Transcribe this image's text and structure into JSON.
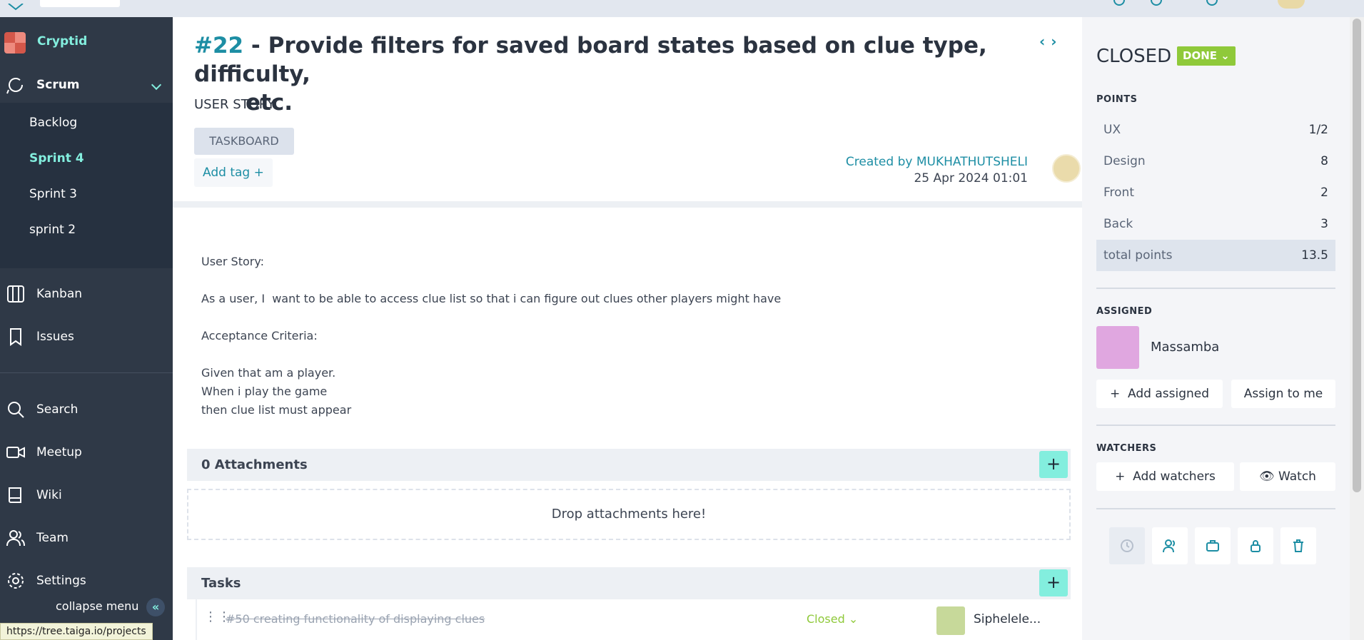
{
  "app": {
    "project_name": "Cryptid"
  },
  "sidebar": {
    "scrum_label": "Scrum",
    "sprints": [
      "Backlog",
      "Sprint 4",
      "Sprint 3",
      "sprint 2"
    ],
    "active_sprint": "Sprint 4",
    "items": [
      {
        "label": "Kanban",
        "icon": "kanban-icon"
      },
      {
        "label": "Issues",
        "icon": "bookmark-icon"
      },
      {
        "label": "Search",
        "icon": "search-icon"
      },
      {
        "label": "Meetup",
        "icon": "video-icon"
      },
      {
        "label": "Wiki",
        "icon": "book-icon"
      },
      {
        "label": "Team",
        "icon": "team-icon"
      },
      {
        "label": "Settings",
        "icon": "gear-icon"
      }
    ],
    "collapse_label": "collapse menu"
  },
  "story": {
    "ref": "#22",
    "dash": "-",
    "title_line1": "Provide filters for saved board states based on clue type, difficulty,",
    "title_line2": "etc.",
    "type": "USER STORY",
    "tag": "TASKBOARD",
    "add_tag": "Add tag",
    "created_by": "Created by MUKHATHUTSHELI",
    "created_date": "25 Apr 2024 01:01",
    "description": [
      "User Story:",
      "",
      "As a user, I  want to be able to access clue list so that i can figure out clues other players might have",
      "",
      "Acceptance Criteria:",
      "",
      "Given that am a player.",
      "When i play the game",
      "then clue list must appear"
    ]
  },
  "attachments": {
    "title": "0 Attachments",
    "drop_text": "Drop attachments here!"
  },
  "tasks": {
    "title": "Tasks",
    "items": [
      {
        "ref": "#50",
        "name": "creating functionality of displaying clues",
        "status": "Closed",
        "assignee": "Siphelele..."
      }
    ]
  },
  "panel": {
    "status": "CLOSED",
    "status_badge": "DONE",
    "points_label": "POINTS",
    "points": [
      {
        "role": "UX",
        "value": "1/2"
      },
      {
        "role": "Design",
        "value": "8"
      },
      {
        "role": "Front",
        "value": "2"
      },
      {
        "role": "Back",
        "value": "3"
      }
    ],
    "total_label": "total points",
    "total_value": "13.5",
    "assigned_label": "ASSIGNED",
    "assignee": "Massamba",
    "add_assigned": "Add assigned",
    "assign_to_me": "Assign to me",
    "watchers_label": "WATCHERS",
    "add_watchers": "Add watchers",
    "watch": "Watch"
  },
  "statusbar": {
    "url": "https://tree.taiga.io/projects"
  },
  "colors": {
    "accent": "#83eede",
    "link": "#1d8ea4",
    "sidebar": "#2f3947",
    "done": "#8fc93a"
  }
}
